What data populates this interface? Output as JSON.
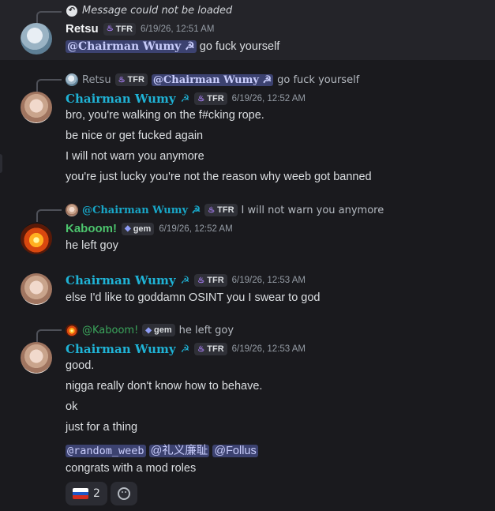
{
  "msg1": {
    "system_text": "Message could not be loaded",
    "author": "Retsu",
    "tag": "TFR",
    "timestamp": "6/19/26, 12:51 AM",
    "mention": "@Chairman Wumy ☭",
    "text": "go fuck yourself"
  },
  "msg2": {
    "reply_author": "Retsu",
    "reply_tag": "TFR",
    "reply_mention": "@Chairman Wumy ☭",
    "reply_text": "go fuck yourself",
    "author": "Chairman Wumy",
    "hammer": "☭",
    "tag": "TFR",
    "timestamp": "6/19/26, 12:52 AM",
    "lines": [
      "bro, you're walking on the f#cking rope.",
      "be nice or get fucked again",
      "I will not warn you anymore",
      "you're just lucky you're not the reason why weeb got banned"
    ]
  },
  "msg3": {
    "reply_author": "@Chairman Wumy ☭",
    "reply_tag": "TFR",
    "reply_text": "I will not warn you anymore",
    "author": "Kaboom!",
    "tag": "gem",
    "timestamp": "6/19/26, 12:52 AM",
    "text": "he left goy"
  },
  "msg4": {
    "author": "Chairman Wumy",
    "hammer": "☭",
    "tag": "TFR",
    "timestamp": "6/19/26, 12:53 AM",
    "text": "else I'd like to goddamn OSINT you I swear to god"
  },
  "msg5": {
    "reply_author": "@Kaboom!",
    "reply_tag": "gem",
    "reply_text": "he left goy",
    "author": "Chairman Wumy",
    "hammer": "☭",
    "tag": "TFR",
    "timestamp": "6/19/26, 12:53 AM",
    "lines": [
      "good.",
      "nigga really don't know how to behave.",
      "ok",
      "just for a thing"
    ],
    "mentions": [
      "@random_weeb",
      "@礼义廉耻",
      "@Follus"
    ],
    "last_line": "congrats with a mod roles",
    "reaction_count": "2"
  },
  "icons": {
    "reply_icon": "reply-arrow-icon",
    "role_icon_tfr": "flame-icon",
    "role_icon_gem": "gem-icon",
    "reaction_flag": "russia-flag-icon",
    "add_reaction": "smile-icon"
  },
  "colors": {
    "background": "#1a1a1e",
    "highlight": "#242429",
    "mention_bg": "#3c4270",
    "mention_fg": "#c9cdfb",
    "chairman_color": "#1fb3d6",
    "kaboom_color": "#4cc46d"
  }
}
